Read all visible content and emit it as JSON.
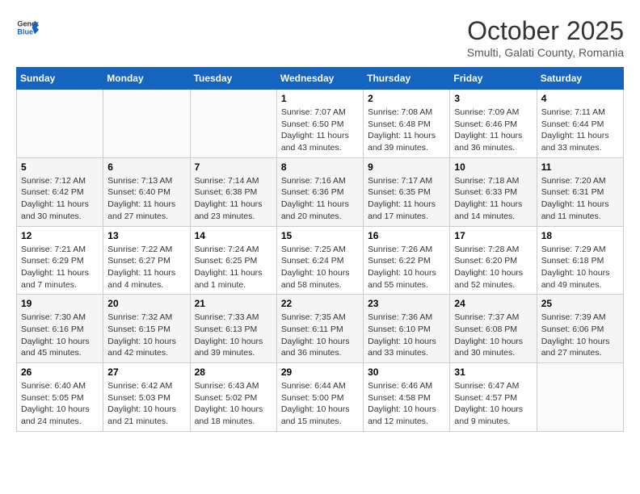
{
  "header": {
    "logo_general": "General",
    "logo_blue": "Blue",
    "title": "October 2025",
    "subtitle": "Smulti, Galati County, Romania"
  },
  "columns": [
    "Sunday",
    "Monday",
    "Tuesday",
    "Wednesday",
    "Thursday",
    "Friday",
    "Saturday"
  ],
  "weeks": [
    [
      {
        "day": "",
        "content": ""
      },
      {
        "day": "",
        "content": ""
      },
      {
        "day": "",
        "content": ""
      },
      {
        "day": "1",
        "content": "Sunrise: 7:07 AM\nSunset: 6:50 PM\nDaylight: 11 hours and 43 minutes."
      },
      {
        "day": "2",
        "content": "Sunrise: 7:08 AM\nSunset: 6:48 PM\nDaylight: 11 hours and 39 minutes."
      },
      {
        "day": "3",
        "content": "Sunrise: 7:09 AM\nSunset: 6:46 PM\nDaylight: 11 hours and 36 minutes."
      },
      {
        "day": "4",
        "content": "Sunrise: 7:11 AM\nSunset: 6:44 PM\nDaylight: 11 hours and 33 minutes."
      }
    ],
    [
      {
        "day": "5",
        "content": "Sunrise: 7:12 AM\nSunset: 6:42 PM\nDaylight: 11 hours and 30 minutes."
      },
      {
        "day": "6",
        "content": "Sunrise: 7:13 AM\nSunset: 6:40 PM\nDaylight: 11 hours and 27 minutes."
      },
      {
        "day": "7",
        "content": "Sunrise: 7:14 AM\nSunset: 6:38 PM\nDaylight: 11 hours and 23 minutes."
      },
      {
        "day": "8",
        "content": "Sunrise: 7:16 AM\nSunset: 6:36 PM\nDaylight: 11 hours and 20 minutes."
      },
      {
        "day": "9",
        "content": "Sunrise: 7:17 AM\nSunset: 6:35 PM\nDaylight: 11 hours and 17 minutes."
      },
      {
        "day": "10",
        "content": "Sunrise: 7:18 AM\nSunset: 6:33 PM\nDaylight: 11 hours and 14 minutes."
      },
      {
        "day": "11",
        "content": "Sunrise: 7:20 AM\nSunset: 6:31 PM\nDaylight: 11 hours and 11 minutes."
      }
    ],
    [
      {
        "day": "12",
        "content": "Sunrise: 7:21 AM\nSunset: 6:29 PM\nDaylight: 11 hours and 7 minutes."
      },
      {
        "day": "13",
        "content": "Sunrise: 7:22 AM\nSunset: 6:27 PM\nDaylight: 11 hours and 4 minutes."
      },
      {
        "day": "14",
        "content": "Sunrise: 7:24 AM\nSunset: 6:25 PM\nDaylight: 11 hours and 1 minute."
      },
      {
        "day": "15",
        "content": "Sunrise: 7:25 AM\nSunset: 6:24 PM\nDaylight: 10 hours and 58 minutes."
      },
      {
        "day": "16",
        "content": "Sunrise: 7:26 AM\nSunset: 6:22 PM\nDaylight: 10 hours and 55 minutes."
      },
      {
        "day": "17",
        "content": "Sunrise: 7:28 AM\nSunset: 6:20 PM\nDaylight: 10 hours and 52 minutes."
      },
      {
        "day": "18",
        "content": "Sunrise: 7:29 AM\nSunset: 6:18 PM\nDaylight: 10 hours and 49 minutes."
      }
    ],
    [
      {
        "day": "19",
        "content": "Sunrise: 7:30 AM\nSunset: 6:16 PM\nDaylight: 10 hours and 45 minutes."
      },
      {
        "day": "20",
        "content": "Sunrise: 7:32 AM\nSunset: 6:15 PM\nDaylight: 10 hours and 42 minutes."
      },
      {
        "day": "21",
        "content": "Sunrise: 7:33 AM\nSunset: 6:13 PM\nDaylight: 10 hours and 39 minutes."
      },
      {
        "day": "22",
        "content": "Sunrise: 7:35 AM\nSunset: 6:11 PM\nDaylight: 10 hours and 36 minutes."
      },
      {
        "day": "23",
        "content": "Sunrise: 7:36 AM\nSunset: 6:10 PM\nDaylight: 10 hours and 33 minutes."
      },
      {
        "day": "24",
        "content": "Sunrise: 7:37 AM\nSunset: 6:08 PM\nDaylight: 10 hours and 30 minutes."
      },
      {
        "day": "25",
        "content": "Sunrise: 7:39 AM\nSunset: 6:06 PM\nDaylight: 10 hours and 27 minutes."
      }
    ],
    [
      {
        "day": "26",
        "content": "Sunrise: 6:40 AM\nSunset: 5:05 PM\nDaylight: 10 hours and 24 minutes."
      },
      {
        "day": "27",
        "content": "Sunrise: 6:42 AM\nSunset: 5:03 PM\nDaylight: 10 hours and 21 minutes."
      },
      {
        "day": "28",
        "content": "Sunrise: 6:43 AM\nSunset: 5:02 PM\nDaylight: 10 hours and 18 minutes."
      },
      {
        "day": "29",
        "content": "Sunrise: 6:44 AM\nSunset: 5:00 PM\nDaylight: 10 hours and 15 minutes."
      },
      {
        "day": "30",
        "content": "Sunrise: 6:46 AM\nSunset: 4:58 PM\nDaylight: 10 hours and 12 minutes."
      },
      {
        "day": "31",
        "content": "Sunrise: 6:47 AM\nSunset: 4:57 PM\nDaylight: 10 hours and 9 minutes."
      },
      {
        "day": "",
        "content": ""
      }
    ]
  ]
}
